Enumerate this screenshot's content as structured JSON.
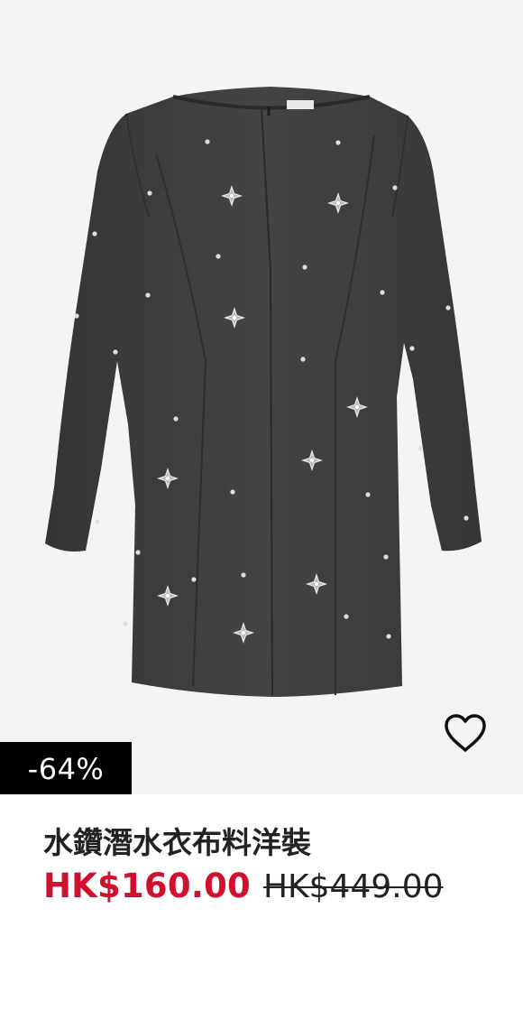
{
  "product": {
    "image_alt": "Dark grey long-sleeve mini dress with rhinestone flower embellishments",
    "discount_badge": "-64%",
    "title": "水鑽潛水衣布料洋裝",
    "price_sale": "HK$160.00",
    "price_original": "HK$449.00"
  },
  "icons": {
    "favorite": "heart-outline-icon"
  },
  "colors": {
    "image_background": "#f4f4f4",
    "dress": "#3d3d3d",
    "badge_background": "#000000",
    "badge_text": "#ffffff",
    "sale_price": "#d20f2c",
    "text": "#222222"
  }
}
